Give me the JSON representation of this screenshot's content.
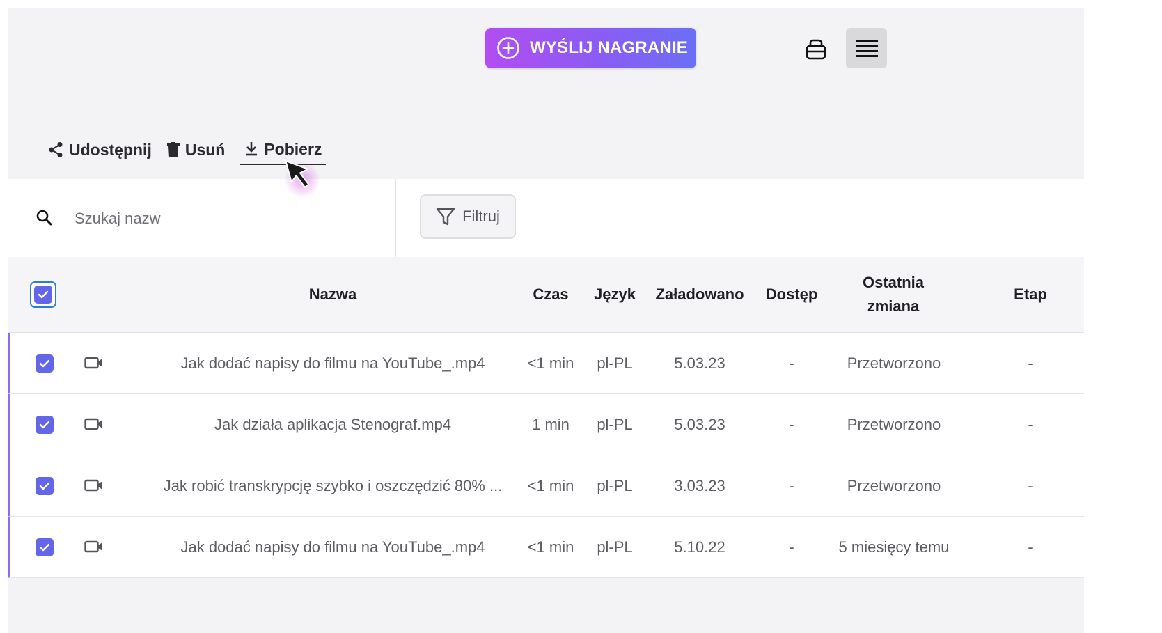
{
  "header": {
    "upload_label": "WYŚLIJ NAGRANIE"
  },
  "actions": {
    "share_label": "Udostępnij",
    "delete_label": "Usuń",
    "download_label": "Pobierz"
  },
  "search": {
    "placeholder": "Szukaj nazw"
  },
  "filter": {
    "label": "Filtruj"
  },
  "table": {
    "columns": {
      "name": "Nazwa",
      "duration": "Czas",
      "language": "Język",
      "uploaded": "Załadowano",
      "access": "Dostęp",
      "last_change": "Ostatnia zmiana",
      "stage": "Etap"
    },
    "rows": [
      {
        "name": "Jak dodać napisy do filmu na YouTube_.mp4",
        "duration": "<1 min",
        "language": "pl-PL",
        "uploaded": "5.03.23",
        "access": "-",
        "last_change": "Przetworzono",
        "stage": "-"
      },
      {
        "name": "Jak działa aplikacja Stenograf.mp4",
        "duration": "1 min",
        "language": "pl-PL",
        "uploaded": "5.03.23",
        "access": "-",
        "last_change": "Przetworzono",
        "stage": "-"
      },
      {
        "name": "Jak robić transkrypcję szybko i oszczędzić 80% ...",
        "duration": "<1 min",
        "language": "pl-PL",
        "uploaded": "3.03.23",
        "access": "-",
        "last_change": "Przetworzono",
        "stage": "-"
      },
      {
        "name": "Jak dodać napisy do filmu na YouTube_.mp4",
        "duration": "<1 min",
        "language": "pl-PL",
        "uploaded": "5.10.22",
        "access": "-",
        "last_change": "5 miesięcy temu",
        "stage": "-"
      }
    ]
  },
  "colors": {
    "accent": "#6366e8",
    "upload_gradient_start": "#b24df2",
    "upload_gradient_end": "#6b6ff5",
    "row_marker": "#8b6cf0"
  }
}
